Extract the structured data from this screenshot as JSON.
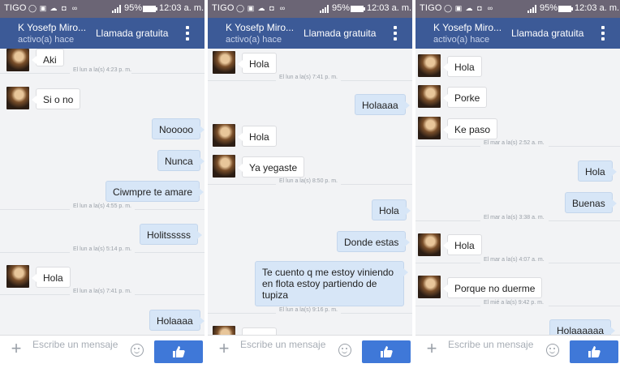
{
  "status": {
    "carrier": "TIGO",
    "battery": "95%",
    "time": "12:03 a. m."
  },
  "header": {
    "contact_name": "K Yosefp Miro...",
    "presence": "activo(a) hace",
    "call_label": "Llamada gratuita"
  },
  "composer": {
    "placeholder": "Escribe un mensaje"
  },
  "colors": {
    "header": "#3c5a97",
    "statusbar": "#6b6575",
    "like_button": "#3f78d8",
    "outgoing_bubble": "#d7e6f7"
  },
  "panels": [
    {
      "messages": [
        {
          "kind": "in",
          "text": "Aki"
        },
        {
          "kind": "ts",
          "text": "El lun a la(s) 4:23 p. m."
        },
        {
          "kind": "in",
          "text": "Si o no"
        },
        {
          "kind": "out",
          "text": "Nooooo"
        },
        {
          "kind": "out",
          "text": "Nunca"
        },
        {
          "kind": "out",
          "text": "Ciwmpre te amare"
        },
        {
          "kind": "ts",
          "text": "El lun a la(s) 4:55 p. m."
        },
        {
          "kind": "out",
          "text": "Holitsssss"
        },
        {
          "kind": "ts",
          "text": "El lun a la(s) 5:14 p. m."
        },
        {
          "kind": "in",
          "text": "Hola"
        },
        {
          "kind": "ts",
          "text": "El lun a la(s) 7:41 p. m."
        },
        {
          "kind": "out",
          "text": "Holaaaa"
        }
      ]
    },
    {
      "messages": [
        {
          "kind": "in",
          "text": "Hola"
        },
        {
          "kind": "ts",
          "text": "El lun a la(s) 7:41 p. m."
        },
        {
          "kind": "out",
          "text": "Holaaaa"
        },
        {
          "kind": "in",
          "text": "Hola"
        },
        {
          "kind": "in",
          "text": "Ya yegaste"
        },
        {
          "kind": "ts",
          "text": "El lun a la(s) 8:50 p. m."
        },
        {
          "kind": "out",
          "text": "Hola"
        },
        {
          "kind": "out",
          "text": "Donde estas"
        },
        {
          "kind": "out",
          "text": "Te cuento q me estoy viniendo en flota estoy partiendo de tupiza"
        },
        {
          "kind": "ts",
          "text": "El lun a la(s) 9:16 p. m."
        },
        {
          "kind": "in",
          "text": "Hola"
        }
      ]
    },
    {
      "messages": [
        {
          "kind": "in",
          "text": "Hola"
        },
        {
          "kind": "in",
          "text": "Porke"
        },
        {
          "kind": "in",
          "text": "Ke paso"
        },
        {
          "kind": "ts",
          "text": "El mar a la(s) 2:52 a. m."
        },
        {
          "kind": "out",
          "text": "Hola"
        },
        {
          "kind": "out",
          "text": "Buenas"
        },
        {
          "kind": "ts",
          "text": "El mar a la(s) 3:38 a. m."
        },
        {
          "kind": "in",
          "text": "Hola"
        },
        {
          "kind": "ts",
          "text": "El mar a la(s) 4:07 a. m."
        },
        {
          "kind": "in",
          "text": "Porque no duerme"
        },
        {
          "kind": "ts",
          "text": "El mié a la(s) 9:42 p. m."
        },
        {
          "kind": "out",
          "text": "Holaaaaaa"
        }
      ]
    }
  ]
}
